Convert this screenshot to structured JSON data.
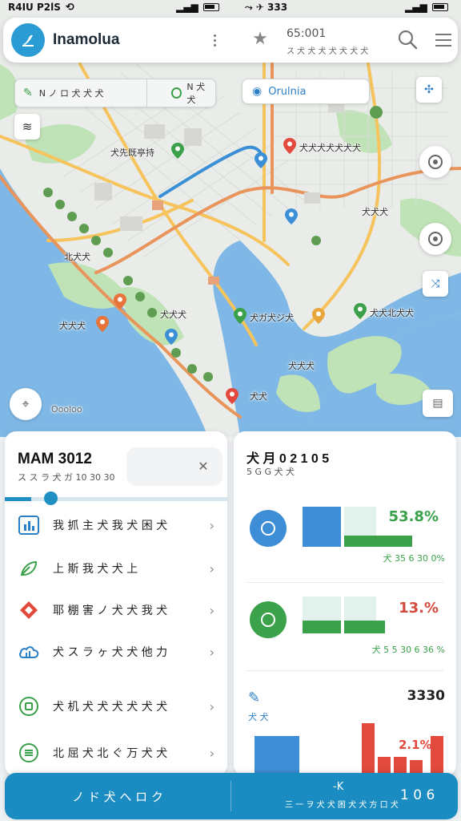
{
  "status_left": {
    "time": "R4IU P2lS",
    "icons": [
      "sync-icon"
    ]
  },
  "status_right": {
    "time": "⤳ ✈ 333"
  },
  "header": {
    "title": "Inamolua",
    "time": "65:001",
    "subtitle": "ス 犬 犬 犬 犬 犬 犬 犬",
    "icons": [
      "logo-icon",
      "more-vertical-icon",
      "star-icon",
      "search-icon",
      "menu-icon"
    ]
  },
  "map": {
    "chip_left": {
      "label": "N ノ ロ 犬 犬 犬",
      "label2": "N 犬 犬"
    },
    "chip_right": {
      "label": "Orulnia"
    },
    "labels": [
      {
        "text": "犬 先 既 亭 持"
      },
      {
        "text": "犬 ツ 犬 犬 犬 犬 犬 犬"
      },
      {
        "text": "犬 北 犬 犬"
      },
      {
        "text": "犬 犬 犬"
      },
      {
        "text": "犬 犬 北 犬"
      },
      {
        "text": "犬 犬 犬 北 犬 犬"
      },
      {
        "text": "犬 犬 犬"
      },
      {
        "text": "犬 犬 犬"
      },
      {
        "text": "犬 犬 犬"
      },
      {
        "text": "犬 犬 犬"
      },
      {
        "text": "犬 犬 犬"
      }
    ],
    "map_labels_text": [
      "犬 先 既 亭 持",
      "犬 ツ 犬 犬 犬 犬 犬 犬",
      "犬 北 犬 犬",
      "犬 犬 犬",
      "犬 犬 北 犬",
      "犬 犬 犬 北 犬 犬"
    ],
    "place_labels": [
      "犬先既亭持",
      "犬犬犬犬犬犬犬",
      "犬犬犬",
      "北犬犬",
      "犬犬犬",
      "犬ガ犬ジ犬",
      "犬犬北犬犬",
      "犬犬犬",
      "犬犬犬",
      "犬犬"
    ],
    "map_attribution": "Oooloo",
    "colors": {
      "water": "#7fb8e6",
      "land": "#ececea",
      "park": "#bfe3b6",
      "road_major": "#f6c35c",
      "road_orange": "#e8945a",
      "route": "#3a8fd6"
    }
  },
  "left_panel": {
    "title": "MAM 3012",
    "subtitle": "ス ス ラ 犬 ガ 10 30 30",
    "field_value": "",
    "progress": 0.12,
    "menu": [
      {
        "label": "我 抓 主 犬 我 犬 困 犬",
        "icon": "chart-icon"
      },
      {
        "label": "上 斯 我 犬 犬 上",
        "icon": "leaf-icon"
      },
      {
        "label": "耶 棚 害 ノ 犬 犬 我 犬",
        "icon": "diamond-icon"
      },
      {
        "label": "犬 ス ラ ヶ 犬 犬 他 力",
        "icon": "cloud-icon"
      },
      {
        "label": "犬 机 犬 犬 犬 犬 犬 犬",
        "icon": "badge-icon"
      },
      {
        "label": "北 屈 犬 北 ぐ 万 犬 犬",
        "icon": "list-icon"
      }
    ]
  },
  "right_panel": {
    "title": "犬 月 0 2 1 0 5",
    "subtitle": "5 G G 犬 犬",
    "stats": [
      {
        "pct": "53.8%",
        "foot": "犬 35 6 30 0%",
        "progress": 0.538,
        "color": "#3d8ed6",
        "pct_color": "#3aa14a",
        "foot_color": "#3aa14a"
      },
      {
        "pct": "13.%",
        "foot": "犬 5 5 30 6 36 %",
        "progress": 0.13,
        "color": "#3ba24b",
        "pct_color": "#d24b3e",
        "foot_color": "#3aa14a"
      }
    ],
    "bottom": {
      "value": "3330",
      "label": "犬 犬",
      "pct": "2.1%",
      "colors": {
        "blue": "#3d8ed6",
        "red": "#e14a3c"
      }
    }
  },
  "bottom_bar": {
    "left_label": "ノ ド 犬 へ ロ ク",
    "mid_top": "-K",
    "mid_bottom": "三 一 ヲ 犬 犬 困 犬 犬 方 口 犬",
    "right_label": "1 0 6"
  }
}
